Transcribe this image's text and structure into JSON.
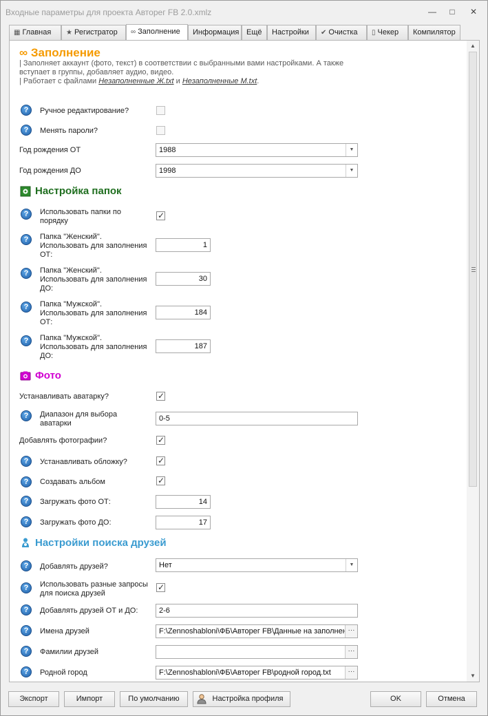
{
  "window": {
    "title": "Входные параметры для проекта Авторег FB 2.0.xmlz",
    "controls": [
      "minimize-icon",
      "maximize-icon",
      "close-icon"
    ]
  },
  "tabs": [
    {
      "label": "Главная",
      "icon": "grid-icon"
    },
    {
      "label": "Регистратор",
      "icon": "star-icon"
    },
    {
      "label": "Заполнение",
      "icon": "infinity-icon",
      "active": true
    },
    {
      "label": "Информация",
      "icon": ""
    },
    {
      "label": "Ещё",
      "icon": ""
    },
    {
      "label": "Настройки",
      "icon": ""
    },
    {
      "label": "Очистка",
      "icon": "checkmark-icon"
    },
    {
      "label": "Чекер",
      "icon": "phone-icon"
    },
    {
      "label": "Компилятор",
      "icon": ""
    }
  ],
  "header": {
    "icon_glyph": "∞",
    "title": "Заполнение",
    "color": "#f59a00",
    "desc_line1": "| Заполняет аккаунт (фото, текст) в соответствии с выбранными вами настройками. А также",
    "desc_line2": "вступает в группы, добавляет аудио, видео.",
    "desc_line3_prefix": "| Работает с файлами ",
    "desc_file1": "Незаполненные Ж.txt",
    "desc_and": " и ",
    "desc_file2": "Незаполненные М.txt",
    "desc_suffix": "."
  },
  "general": {
    "manual_edit_label": "Ручное редактирование?",
    "manual_edit_checked": false,
    "change_pass_label": "Менять пароли?",
    "change_pass_checked": false,
    "birth_from_label": "Год рождения ОТ",
    "birth_from_value": "1988",
    "birth_to_label": "Год рождения ДО",
    "birth_to_value": "1998"
  },
  "folders": {
    "title": "Настройка папок",
    "color": "#1f6e1f",
    "use_in_order_label_1": "Использовать папки по",
    "use_in_order_label_2": "порядку",
    "use_in_order_checked": true,
    "f_from_l1": "Папка \"Женский\".",
    "f_from_l2": "Использовать для заполнения",
    "f_from_l3": "ОТ:",
    "f_from_value": "1",
    "f_to_l1": "Папка \"Женский\".",
    "f_to_l2": "Использовать для заполнения",
    "f_to_l3": "ДО:",
    "f_to_value": "30",
    "m_from_l1": "Папка \"Мужской\".",
    "m_from_l2": "Использовать для заполнения",
    "m_from_l3": "ОТ:",
    "m_from_value": "184",
    "m_to_l1": "Папка \"Мужской\".",
    "m_to_l2": "Использовать для заполнения",
    "m_to_l3": "ДО:",
    "m_to_value": "187"
  },
  "photo": {
    "title": "Фото",
    "color": "#d100d1",
    "set_avatar_label": "Устанавливать аватарку?",
    "set_avatar_checked": true,
    "avatar_range_l1": "Диапазон для выбора",
    "avatar_range_l2": "аватарки",
    "avatar_range_value": "0-5",
    "add_photos_label": "Добавлять фотографии?",
    "add_photos_checked": true,
    "set_cover_label": "Устанавливать обложку?",
    "set_cover_checked": true,
    "create_album_label": "Создавать альбом",
    "create_album_checked": true,
    "load_from_label": "Загружать фото ОТ:",
    "load_from_value": "14",
    "load_to_label": "Загружать фото ДО:",
    "load_to_value": "17"
  },
  "friends": {
    "title": "Настройки поиска друзей",
    "color": "#3a9bd0",
    "add_friends_label": "Добавлять друзей?",
    "add_friends_value": "Нет",
    "diff_queries_l1": "Использовать разные запросы",
    "diff_queries_l2": "для поиска друзей",
    "diff_queries_checked": true,
    "range_label": "Добавлять друзей ОТ и ДО:",
    "range_value": "2-6",
    "names_label": "Имена друзей",
    "names_value": "F:\\Zennoshabloni\\ФБ\\Авторег FB\\Данные на заполнен",
    "surnames_label": "Фамилии друзей",
    "surnames_value": "",
    "city_label": "Родной город",
    "city_value": "F:\\Zennoshabloni\\ФБ\\Авторег FB\\родной город.txt"
  },
  "footer": {
    "export": "Экспорт",
    "import": "Импорт",
    "default": "По умолчанию",
    "profile": "Настройка профиля",
    "ok": "OK",
    "cancel": "Отмена"
  },
  "help_glyph": "?",
  "combo_glyph": "▼",
  "dots_glyph": "···"
}
